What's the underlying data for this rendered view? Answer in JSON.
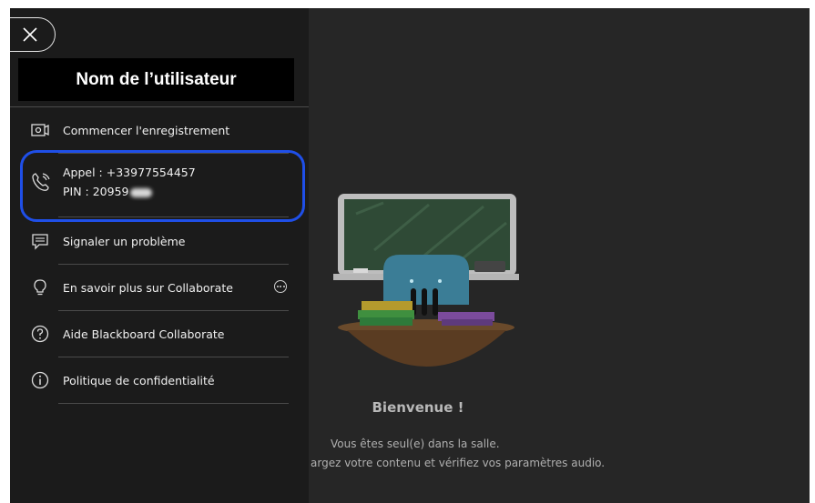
{
  "panel": {
    "user_name": "Nom de l’utilisateur",
    "menu": {
      "start_recording": "Commencer l'enregistrement",
      "call_label": "Appel : +33977554457",
      "pin_label": "PIN : 20959",
      "report_problem": "Signaler un problème",
      "learn_more": "En savoir plus sur Collaborate",
      "help": "Aide Blackboard Collaborate",
      "privacy": "Politique de confidentialité"
    }
  },
  "main": {
    "welcome_title": "Bienvenue !",
    "alone_text": "Vous êtes seul(e) dans la salle.",
    "upload_text": "argez votre contenu et vérifiez vos paramètres audio."
  },
  "colors": {
    "panel_bg": "#1b1b1b",
    "main_bg": "#262626",
    "highlight": "#1f4fe8"
  },
  "icons": [
    "close-icon",
    "camera-icon",
    "phone-icon",
    "feedback-icon",
    "lightbulb-icon",
    "more-options-icon",
    "help-icon",
    "info-icon"
  ]
}
